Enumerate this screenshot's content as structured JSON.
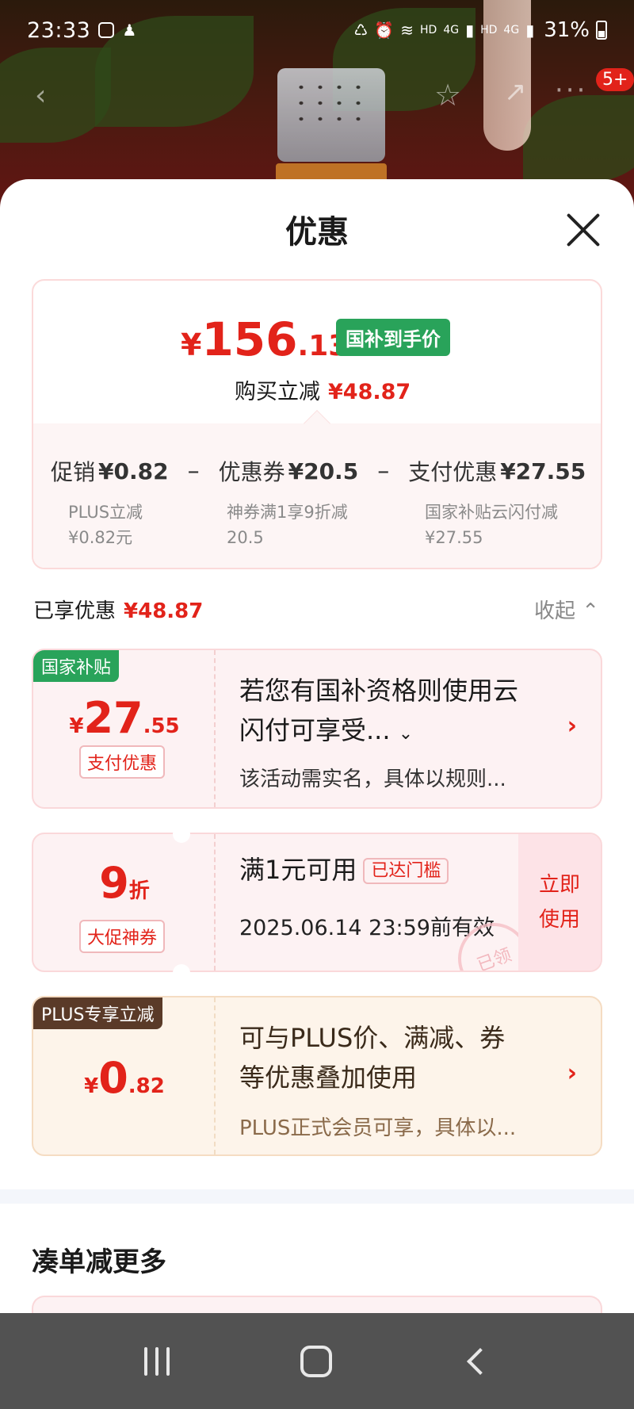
{
  "status": {
    "time": "23:33",
    "signal_hd_1": "HD",
    "signal_4g_1": "4G",
    "signal_hd_2": "HD",
    "signal_4g_2": "4G",
    "battery": "31%"
  },
  "background": {
    "badge": "5+"
  },
  "sheet": {
    "title": "优惠"
  },
  "summary": {
    "price_yen": "¥",
    "price_int": "156",
    "price_dec": ".13",
    "tag": "国补到手价",
    "buy_label": "购买立减",
    "buy_amount": "¥48.87",
    "promo_label": "促销",
    "promo_amount": "¥0.82",
    "coupon_label": "优惠券",
    "coupon_amount": "¥20.5",
    "pay_label": "支付优惠",
    "pay_amount": "¥27.55",
    "minus": "–",
    "promo_sub_1": "PLUS立减",
    "promo_sub_2": "¥0.82元",
    "coupon_sub_1": "神券满1享9折减",
    "coupon_sub_2": "20.5",
    "pay_sub_1": "国家补贴云闪付减",
    "pay_sub_2": "¥27.55"
  },
  "enjoyed": {
    "label": "已享优惠",
    "amount": "¥48.87",
    "collapse": "收起"
  },
  "cards": [
    {
      "corner": "国家补贴",
      "yen": "¥",
      "int": "27",
      "dec": ".55",
      "type": "支付优惠",
      "desc_1": "若您有国补资格则使用云",
      "desc_2": "闪付可享受...",
      "small": "该活动需实名，具体以规则..."
    },
    {
      "int": "9",
      "unit": "折",
      "type": "大促神券",
      "desc": "满1元可用",
      "reached": "已达门槛",
      "small": "2025.06.14 23:59前有效",
      "use_1": "立即",
      "use_2": "使用",
      "stamp": "已领"
    },
    {
      "corner": "PLUS专享立减",
      "yen": "¥",
      "int": "0",
      "dec": ".82",
      "desc_1": "可与PLUS价、满减、券",
      "desc_2": "等优惠叠加使用",
      "small": "PLUS正式会员可享，具体以..."
    }
  ],
  "more": {
    "title": "凑单减更多"
  },
  "colors": {
    "accent_red": "#e2231a",
    "green_tag": "#29a35a",
    "plus_tag": "#5a3a28"
  }
}
